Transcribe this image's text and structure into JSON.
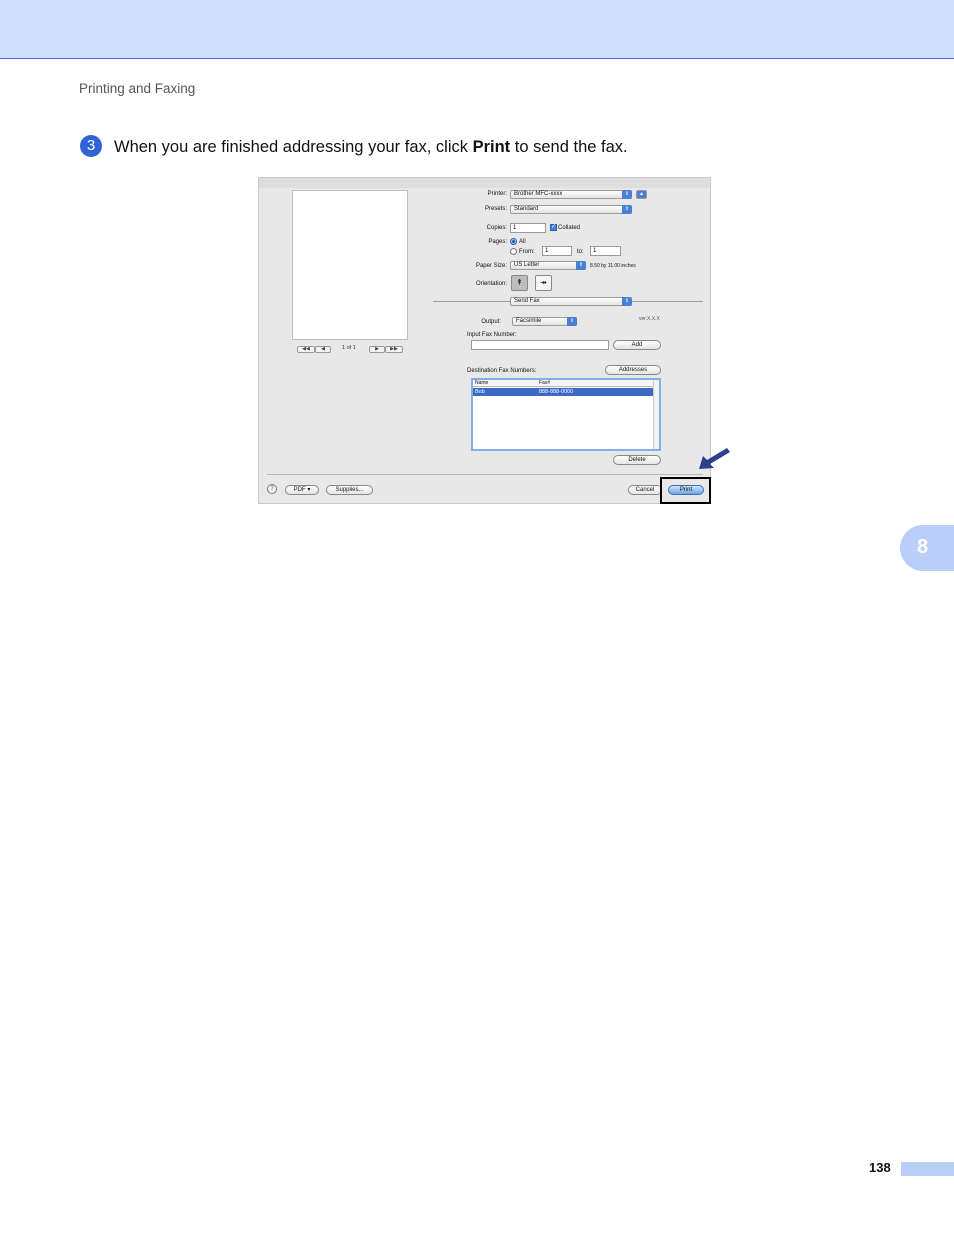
{
  "header": {
    "section": "Printing and Faxing"
  },
  "step": {
    "number": "3",
    "before": "When you are finished addressing your fax, click ",
    "bold": "Print",
    "after": " to send the fax."
  },
  "chapter_tab": "8",
  "page_number": "138",
  "dialog": {
    "preview_nav": {
      "first": "◀◀",
      "prev": "◀",
      "page_label": "1 of 1",
      "next": "▶",
      "last": "▶▶"
    },
    "printer": {
      "label": "Printer:",
      "value": "Brother MFC-xxxx"
    },
    "presets": {
      "label": "Presets:",
      "value": "Standard"
    },
    "copies": {
      "label": "Copies:",
      "value": "1",
      "collated_label": "Collated"
    },
    "pages": {
      "label": "Pages:",
      "all_label": "All",
      "from_label": "From:",
      "from_value": "1",
      "to_label": "to:",
      "to_value": "1"
    },
    "paper_size": {
      "label": "Paper Size:",
      "value": "US Letter",
      "note": "8.50 by 11.00 inches"
    },
    "orientation": {
      "label": "Orientation:"
    },
    "panel": {
      "value": "Send Fax"
    },
    "output": {
      "label": "Output:",
      "value": "Facsimile"
    },
    "version": "ver.X.X.X",
    "fax_input": {
      "label": "Input Fax Number:",
      "value": "",
      "add_label": "Add"
    },
    "destination": {
      "label": "Destination Fax Numbers:",
      "addresses_label": "Addresses",
      "columns": [
        "Name",
        "Fax#"
      ],
      "rows": [
        {
          "name": "Bob",
          "fax": "888-888-0000"
        }
      ],
      "delete_label": "Delete"
    },
    "footer": {
      "help": "?",
      "pdf_label": "PDF ▾",
      "supplies_label": "Supplies...",
      "cancel_label": "Cancel",
      "print_label": "Print"
    }
  }
}
